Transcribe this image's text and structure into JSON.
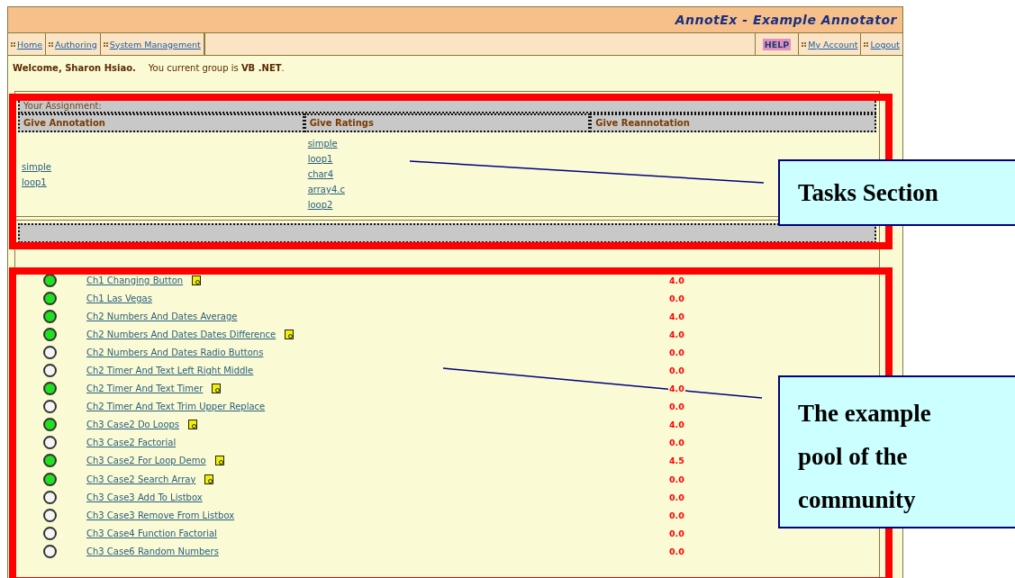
{
  "app_title": "AnnotEx - Example Annotator",
  "nav_left": [
    {
      "label": "Home"
    },
    {
      "label": "Authoring"
    },
    {
      "label": "System Management"
    }
  ],
  "help": "HELP",
  "nav_right": [
    {
      "label": "My Account"
    },
    {
      "label": "Logout"
    }
  ],
  "welcome": {
    "greeting": "Welcome, Sharon Hsiao.",
    "group_text": "You current group is **VB .NET**."
  },
  "assignment": {
    "title": "Your Assignment:",
    "columns": [
      {
        "heading": "Give Annotation",
        "links": [
          "simple",
          "loop1"
        ]
      },
      {
        "heading": "Give Ratings",
        "links": [
          "simple",
          "loop1",
          "char4",
          "array4.c",
          "loop2"
        ]
      },
      {
        "heading": "Give Reannotation"
      }
    ]
  },
  "examples": [
    {
      "name": "Ch1 Changing Button",
      "annotated": true,
      "has_note": true,
      "rating": "4.0"
    },
    {
      "name": "Ch1 Las Vegas",
      "annotated": true,
      "has_note": false,
      "rating": "0.0"
    },
    {
      "name": "Ch2 Numbers And Dates Average",
      "annotated": true,
      "has_note": false,
      "rating": "4.0"
    },
    {
      "name": "Ch2 Numbers And Dates Dates Difference",
      "annotated": true,
      "has_note": true,
      "rating": "4.0"
    },
    {
      "name": "Ch2 Numbers And Dates Radio Buttons",
      "annotated": false,
      "has_note": false,
      "rating": "0.0"
    },
    {
      "name": "Ch2 Timer And Text Left Right Middle",
      "annotated": false,
      "has_note": false,
      "rating": "0.0"
    },
    {
      "name": "Ch2 Timer And Text Timer",
      "annotated": true,
      "has_note": true,
      "rating": "4.0"
    },
    {
      "name": "Ch2 Timer And Text Trim Upper Replace",
      "annotated": false,
      "has_note": false,
      "rating": "0.0"
    },
    {
      "name": "Ch3 Case2 Do Loops",
      "annotated": true,
      "has_note": true,
      "rating": "4.0"
    },
    {
      "name": "Ch3 Case2 Factorial",
      "annotated": false,
      "has_note": false,
      "rating": "0.0"
    },
    {
      "name": "Ch3 Case2 For Loop Demo",
      "annotated": true,
      "has_note": true,
      "rating": "4.5"
    },
    {
      "name": "Ch3 Case2 Search Array",
      "annotated": true,
      "has_note": true,
      "rating": "0.0"
    },
    {
      "name": "Ch3 Case3 Add To Listbox",
      "annotated": false,
      "has_note": false,
      "rating": "0.0"
    },
    {
      "name": "Ch3 Case3 Remove From Listbox",
      "annotated": false,
      "has_note": false,
      "rating": "0.0"
    },
    {
      "name": "Ch3 Case4 Function Factorial",
      "annotated": false,
      "has_note": false,
      "rating": "0.0"
    },
    {
      "name": "Ch3 Case6 Random Numbers",
      "annotated": false,
      "has_note": false,
      "rating": "0.0"
    }
  ],
  "callouts": [
    {
      "text": "Tasks Section"
    },
    {
      "text": "The example pool of the community"
    }
  ]
}
